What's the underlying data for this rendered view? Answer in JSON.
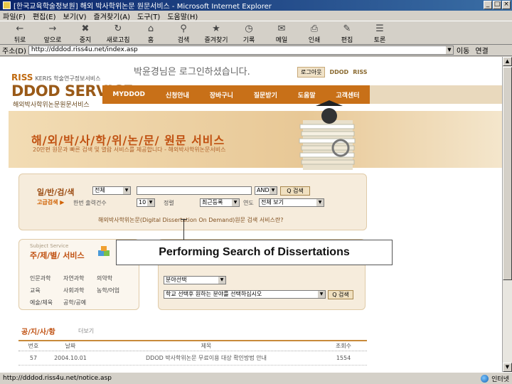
{
  "window": {
    "title": "[한국교육학술정보원] 해외 박사학위논문 원문서비스 - Microsoft Internet Explorer",
    "controls": [
      "_",
      "□",
      "×"
    ]
  },
  "menu": [
    "파일(F)",
    "편집(E)",
    "보기(V)",
    "즐겨찾기(A)",
    "도구(T)",
    "도움말(H)"
  ],
  "toolbar": [
    {
      "label": "뒤로",
      "icon": "back-arrow-icon",
      "glyph": "←"
    },
    {
      "label": "앞으로",
      "icon": "forward-arrow-icon",
      "glyph": "→"
    },
    {
      "label": "중지",
      "icon": "stop-icon",
      "glyph": "✖"
    },
    {
      "label": "새로고침",
      "icon": "refresh-icon",
      "glyph": "↻"
    },
    {
      "label": "홈",
      "icon": "home-icon",
      "glyph": "⌂"
    },
    {
      "label": "검색",
      "icon": "search-icon",
      "glyph": "⚲"
    },
    {
      "label": "즐겨찾기",
      "icon": "favorites-icon",
      "glyph": "★"
    },
    {
      "label": "기록",
      "icon": "history-icon",
      "glyph": "◷"
    },
    {
      "label": "메일",
      "icon": "mail-icon",
      "glyph": "✉"
    },
    {
      "label": "인쇄",
      "icon": "print-icon",
      "glyph": "⎙"
    },
    {
      "label": "편집",
      "icon": "edit-icon",
      "glyph": "✎"
    },
    {
      "label": "토론",
      "icon": "discuss-icon",
      "glyph": "☰"
    }
  ],
  "address": {
    "label": "주소(D)",
    "url": "http://dddod.riss4u.net/index.asp",
    "go": "이동",
    "links": "연결"
  },
  "page": {
    "logo_riss": "RISS",
    "logo_org": "KERIS 학술연구정보서비스",
    "logo_main": "DDOD SERVICE",
    "logo_sub": "해외박사학위논문원문서비스",
    "welcome": "박윤경님은 로그인하셨습니다.",
    "logout": "로그아웃",
    "brand1": "DDOD",
    "brand2": "RISS",
    "nav": [
      "MYDDOD",
      "신청안내",
      "장바구니",
      "질문받기",
      "도움말",
      "고객센터"
    ],
    "banner_title": "해/외/박/사/학/위/논/문/ 원문 서비스",
    "banner_sub": "20만편 원문과 빠른 검색 및 열람 서비스를 제공합니다 - 해외박사학위논문서비스",
    "search_label": "일/반/검/색",
    "adv_link": "고급검색 ▶",
    "field_select": "전체",
    "and_select": "AND",
    "search_button": "Q 검색",
    "row2_text1": "한번 출력건수",
    "rows_select": "10",
    "row2_text2": "정렬",
    "sort_select": "최근등록",
    "row2_text3": "연도",
    "year_select": "전체 보기",
    "dod_link": "해외박사학위논문(Digital Dissertation On Demand)원문 검색 서비스란?",
    "subject_small": "Subject Service",
    "subject_title": "주/제/별/ 서비스",
    "subjects": [
      [
        "인문과학",
        "자연과학",
        "의약학"
      ],
      [
        "교육",
        "사회과학",
        "농학/어업"
      ],
      [
        "예술/체육",
        "공학/공예"
      ]
    ],
    "subject_select": "분야선택",
    "school_select": "학교 선택후 원하는 분야를 선택하십시오",
    "search_button2": "Q 검색",
    "notice_title": "공/지/사/항",
    "notice_more": "더보기",
    "notice_headers": [
      "번호",
      "날짜",
      "제목",
      "조회수"
    ],
    "notice_rows": [
      [
        "57",
        "2004.10.01",
        "DDOD 박사학위논문 무료이용 대상 확인방법 안내",
        "1554"
      ]
    ]
  },
  "callout": {
    "text": "Performing Search of Dissertations"
  },
  "status": {
    "url": "http://dddod.riss4u.net/notice.asp",
    "zone": "인터넷"
  }
}
